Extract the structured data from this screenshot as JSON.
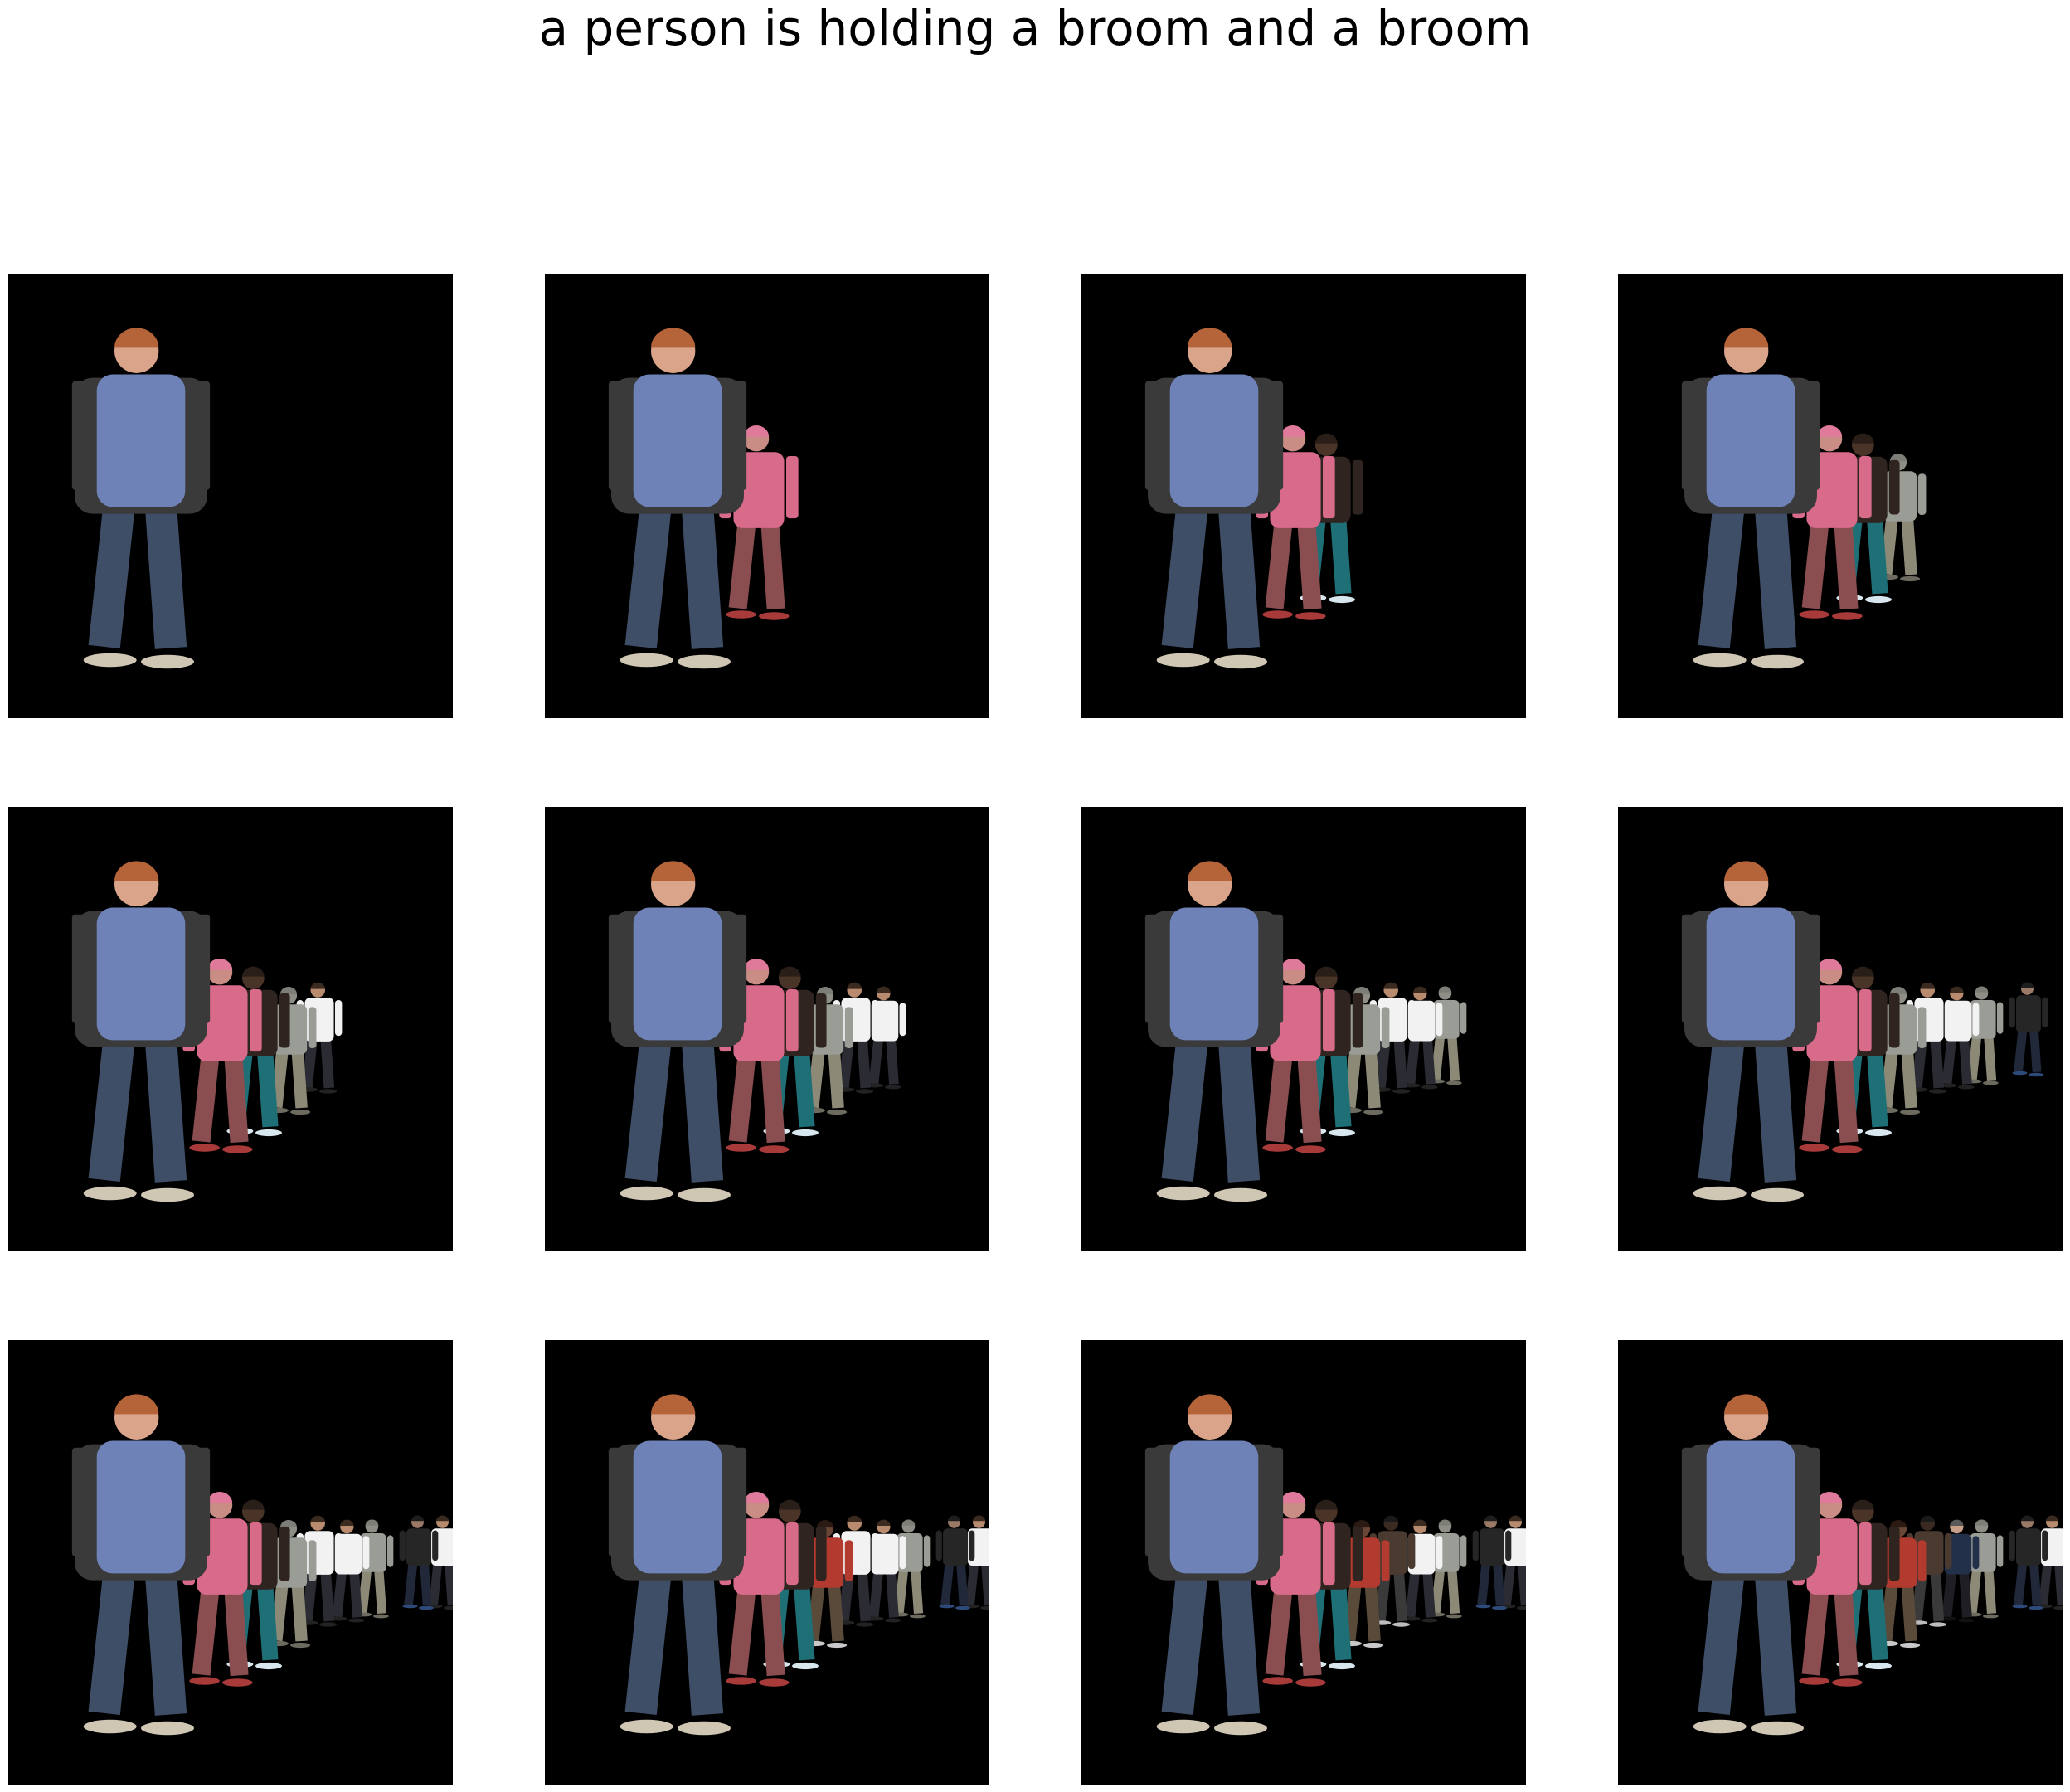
{
  "title": "a person is holding a broom and a broom",
  "figure": {
    "layout": "3 rows x 4 columns of image panels, black backgrounds",
    "panels": [
      {
        "figures": [
          "man-jeans"
        ]
      },
      {
        "figures": [
          "man-jeans",
          "woman-pink"
        ]
      },
      {
        "figures": [
          "man-jeans",
          "woman-pink",
          "woman-teal"
        ]
      },
      {
        "figures": [
          "man-jeans",
          "woman-pink",
          "woman-teal",
          "blurred-person"
        ]
      },
      {
        "figures": [
          "man-jeans",
          "woman-pink",
          "woman-teal",
          "blurred-person",
          "white-shirt-man"
        ]
      },
      {
        "figures": [
          "man-jeans",
          "woman-pink",
          "woman-teal",
          "blurred-person",
          "white-shirt-man",
          "white-shirt-man"
        ]
      },
      {
        "figures": [
          "man-jeans",
          "woman-pink",
          "woman-teal",
          "blurred-person",
          "white-shirt-man",
          "white-shirt-man",
          "blurred-person"
        ]
      },
      {
        "figures": [
          "man-jeans",
          "woman-pink",
          "woman-teal",
          "blurred-person",
          "white-shirt-man",
          "white-shirt-man",
          "blurred-person",
          "dark-jacket-man"
        ]
      },
      {
        "figures": [
          "man-jeans",
          "woman-pink",
          "woman-teal",
          "blurred-person",
          "white-shirt-man",
          "white-shirt-man",
          "blurred-person",
          "dark-jacket-man",
          "white-shirt-man"
        ]
      },
      {
        "figures": [
          "man-jeans",
          "woman-pink",
          "woman-teal",
          "red-shirt-person",
          "white-shirt-man",
          "white-shirt-man",
          "blurred-person",
          "dark-jacket-man",
          "white-shirt-man"
        ]
      },
      {
        "figures": [
          "man-jeans",
          "woman-pink",
          "woman-teal",
          "red-shirt-person",
          "dark-person",
          "white-shirt-man",
          "blurred-person",
          "dark-jacket-man",
          "white-shirt-man"
        ]
      },
      {
        "figures": [
          "man-jeans",
          "woman-pink",
          "woman-teal",
          "red-shirt-person",
          "dark-person",
          "suit-man",
          "blurred-person",
          "dark-jacket-man",
          "white-shirt-man"
        ]
      }
    ]
  },
  "colors": {
    "background": "#ffffff",
    "panel": "#000000"
  }
}
